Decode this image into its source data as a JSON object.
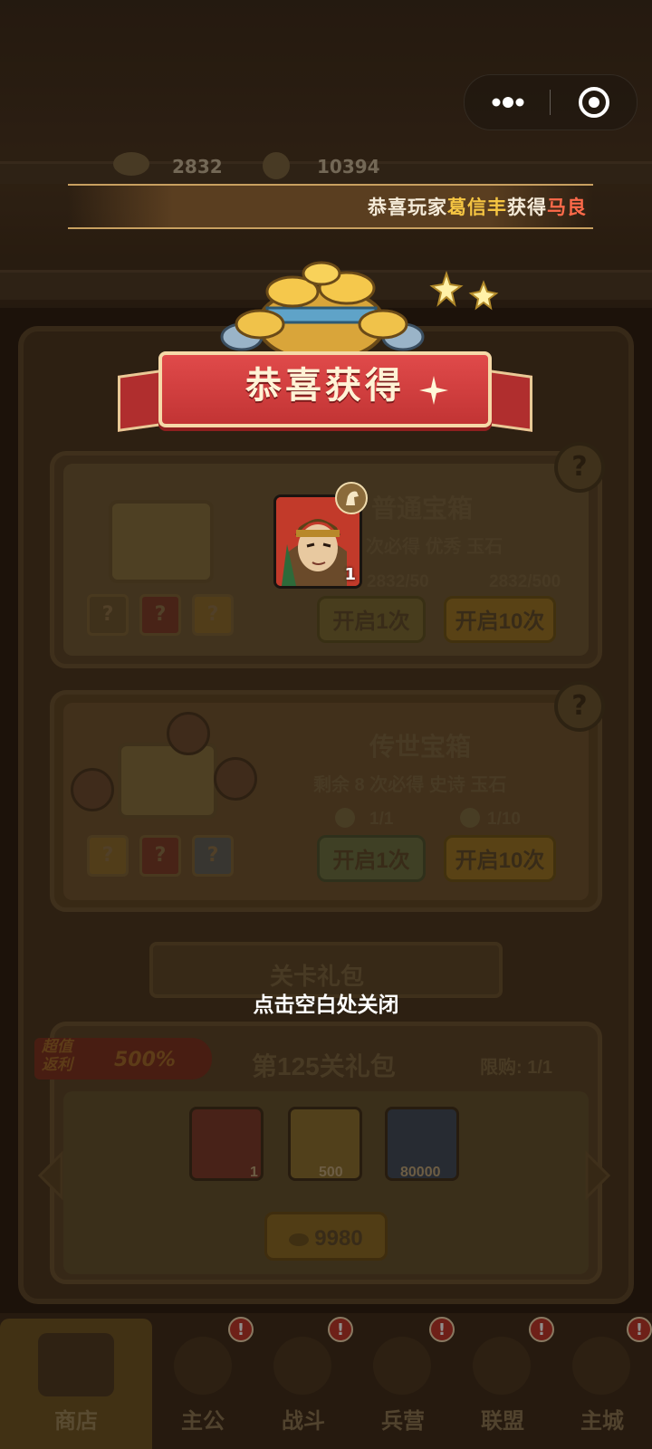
{
  "resources": {
    "gold": "2832",
    "silver": "10394"
  },
  "ticker": {
    "prefix": "恭喜玩家",
    "player": "葛信丰",
    "middle": "获得",
    "item": "马良"
  },
  "popup": {
    "title": "恭喜获得",
    "reward": {
      "hero": "马良",
      "count": "1"
    },
    "close_hint": "点击空白处关闭"
  },
  "shop": {
    "normal_chest": {
      "title": "普通宝箱",
      "subtitle_count": "次必得",
      "subtitle_quality": "优秀",
      "subtitle_item": "玉石",
      "cost1": "2832/50",
      "cost10": "2832/500",
      "btn1": "开启1次",
      "btn10": "开启10次"
    },
    "legend_chest": {
      "title": "传世宝箱",
      "subtitle": "剩余 8 次必得",
      "subtitle_quality": "史诗",
      "subtitle_item": "玉石",
      "cost1": "1/1",
      "cost10": "1/10",
      "btn1": "开启1次",
      "btn10": "开启10次"
    },
    "stage_pack": {
      "section_title": "关卡礼包",
      "badge_line1": "超值",
      "badge_line2": "返利",
      "badge_value": "500%",
      "title": "第125关礼包",
      "limit": "限购: 1/1",
      "items": [
        {
          "icon": "scroll-icon",
          "count": "1"
        },
        {
          "icon": "iron-ore-icon",
          "count": "500"
        },
        {
          "icon": "coin-icon",
          "count": "80000"
        }
      ],
      "price": "9980"
    }
  },
  "tabs": [
    {
      "label": "商店",
      "active": true,
      "badge": ""
    },
    {
      "label": "主公",
      "active": false,
      "badge": "!"
    },
    {
      "label": "战斗",
      "active": false,
      "badge": "!"
    },
    {
      "label": "兵营",
      "active": false,
      "badge": "!"
    },
    {
      "label": "联盟",
      "active": false,
      "badge": "!"
    },
    {
      "label": "主城",
      "active": false,
      "badge": "!"
    }
  ],
  "colors": {
    "ribbon": "#d23c3c",
    "highlight_name": "#f5c542",
    "highlight_item": "#ff6a4a",
    "active_tab": "#a07a2a"
  }
}
